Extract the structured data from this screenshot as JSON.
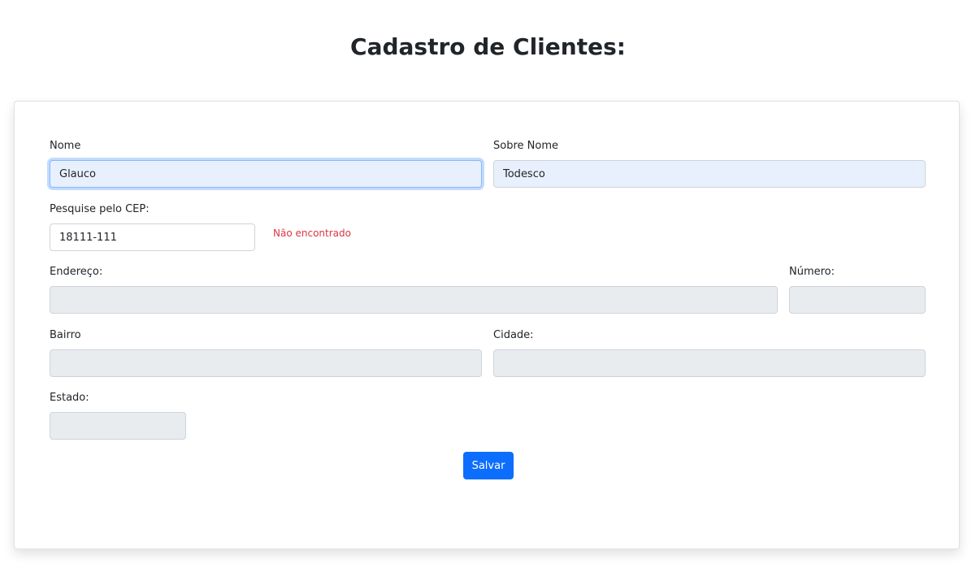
{
  "page": {
    "title": "Cadastro de Clientes:"
  },
  "form": {
    "nome": {
      "label": "Nome",
      "value": "Glauco"
    },
    "sobrenome": {
      "label": "Sobre Nome",
      "value": "Todesco"
    },
    "cep": {
      "label": "Pesquise pelo CEP:",
      "value": "18111-111",
      "error": "Não encontrado"
    },
    "endereco": {
      "label": "Endereço:",
      "value": ""
    },
    "numero": {
      "label": "Número:",
      "value": ""
    },
    "bairro": {
      "label": "Bairro",
      "value": ""
    },
    "cidade": {
      "label": "Cidade:",
      "value": ""
    },
    "estado": {
      "label": "Estado:",
      "value": ""
    },
    "submit_label": "Salvar"
  },
  "colors": {
    "primary": "#0d6efd",
    "error": "#dc3545",
    "autofill": "#e8f0fe",
    "disabled": "#e9ecef"
  }
}
